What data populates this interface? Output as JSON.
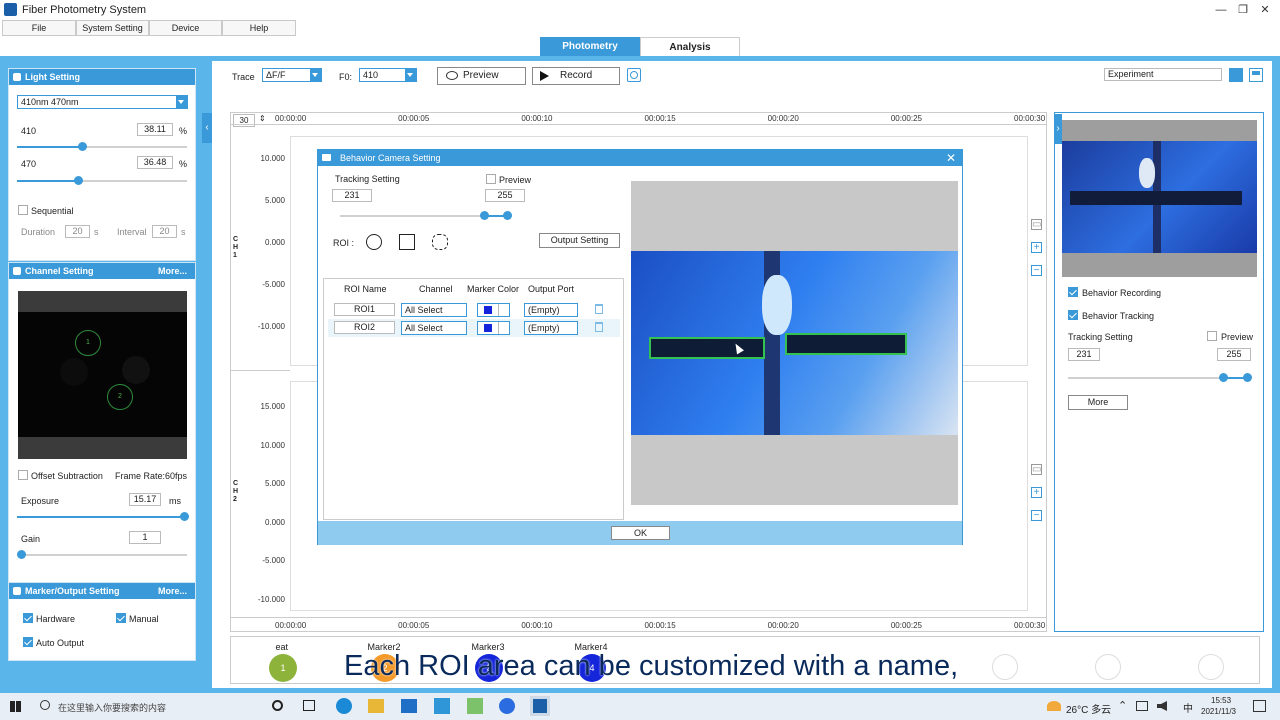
{
  "window": {
    "title": "Fiber Photometry System"
  },
  "menu": [
    "File",
    "System Setting",
    "Device",
    "Help"
  ],
  "tabs": {
    "photometry": "Photometry",
    "analysis": "Analysis"
  },
  "light_setting": {
    "title": "Light Setting",
    "wavelength_select": "410nm   470nm",
    "ch410_label": "410",
    "ch410_value": "38.11",
    "ch410_level": 0.38,
    "ch470_label": "470",
    "ch470_value": "36.48",
    "ch470_level": 0.36,
    "unit": "%",
    "sequential_label": "Sequential",
    "duration_label": "Duration",
    "duration_value": "20",
    "duration_unit": "s",
    "interval_label": "Interval",
    "interval_value": "20",
    "interval_unit": "s"
  },
  "channel_setting": {
    "title": "Channel Setting",
    "more": "More...",
    "roi1": "1",
    "roi2": "2",
    "offset_label": "Offset Subtraction",
    "frame_rate": "Frame Rate:60fps",
    "exposure_label": "Exposure",
    "exposure_value": "15.17",
    "exposure_unit": "ms",
    "gain_label": "Gain",
    "gain_value": "1"
  },
  "marker_setting": {
    "title": "Marker/Output Setting",
    "more": "More...",
    "hardware": "Hardware",
    "manual": "Manual",
    "auto_output": "Auto Output"
  },
  "toolbar": {
    "trace_label": "Trace",
    "trace_value": "ΔF/F",
    "f0_label": "F0:",
    "f0_value": "410",
    "preview": "Preview",
    "record": "Record",
    "experiment": "Experiment"
  },
  "chart": {
    "window_value": "30",
    "time_ticks": [
      "00:00:00",
      "00:00:05",
      "00:00:10",
      "00:00:15",
      "00:00:20",
      "00:00:25",
      "00:00:30"
    ],
    "ch1_label": "C\nH\n1",
    "ch2_label": "C\nH\n2",
    "ch1_yticks": [
      "10.000",
      "5.000",
      "0.000",
      "-5.000",
      "-10.000"
    ],
    "ch2_yticks": [
      "15.000",
      "10.000",
      "5.000",
      "0.000",
      "-5.000",
      "-10.000"
    ]
  },
  "markers": [
    {
      "name": "eat",
      "num": "1",
      "color": "#8db33a"
    },
    {
      "name": "Marker2",
      "num": "2",
      "color": "#f39a2b"
    },
    {
      "name": "Marker3",
      "num": "3",
      "color": "#1525d9"
    },
    {
      "name": "Marker4",
      "num": "4",
      "color": "#1525d9"
    }
  ],
  "dialog": {
    "title": "Behavior Camera Setting",
    "tracking_label": "Tracking Setting",
    "preview_label": "Preview",
    "low_value": "231",
    "high_value": "255",
    "roi_label": "ROI :",
    "output_setting": "Output Setting",
    "headers": [
      "ROI Name",
      "Channel",
      "Marker Color",
      "Output Port"
    ],
    "rows": [
      {
        "name": "ROI1",
        "channel": "All Select",
        "port": "(Empty)"
      },
      {
        "name": "ROI2",
        "channel": "All Select",
        "port": "(Empty)"
      }
    ],
    "ok": "OK"
  },
  "right_panel": {
    "behavior_recording": "Behavior Recording",
    "behavior_tracking": "Behavior Tracking",
    "tracking_label": "Tracking Setting",
    "preview_label": "Preview",
    "low_value": "231",
    "high_value": "255",
    "more": "More"
  },
  "subtitle": "Each ROI area can be customized with a name,",
  "taskbar": {
    "search_placeholder": "在这里输入你要搜索的内容",
    "weather": "26°C 多云",
    "ime": "中",
    "time": "15:53",
    "date": "2021/11/3"
  },
  "colors": {
    "accent": "#3a99d8",
    "frame": "#5ab6ea",
    "marker_blue": "#1525d9"
  }
}
